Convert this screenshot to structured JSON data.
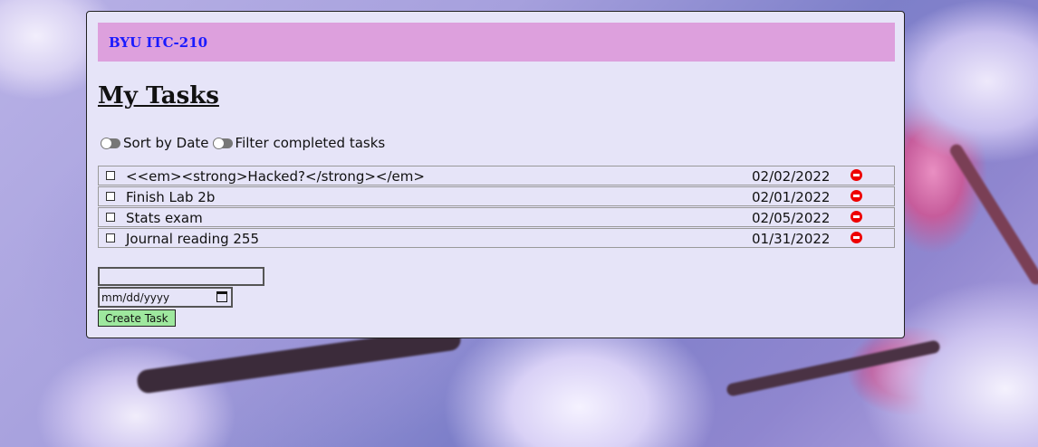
{
  "header": {
    "brand": "BYU ITC-210"
  },
  "page": {
    "title": "My Tasks"
  },
  "controls": {
    "sort_label": "Sort by Date",
    "filter_label": "Filter completed tasks"
  },
  "tasks": [
    {
      "name": "<<em><strong>Hacked?</strong></em>",
      "date": "02/02/2022",
      "completed": false
    },
    {
      "name": "Finish Lab 2b",
      "date": "02/01/2022",
      "completed": false
    },
    {
      "name": "Stats exam",
      "date": "02/05/2022",
      "completed": false
    },
    {
      "name": "Journal reading 255",
      "date": "01/31/2022",
      "completed": false
    }
  ],
  "form": {
    "name_value": "",
    "date_placeholder": "mm/dd/yyyy",
    "create_label": "Create Task"
  },
  "icons": {
    "delete": "minus-circle-icon",
    "calendar": "calendar-icon",
    "checkbox": "checkbox-icon"
  },
  "colors": {
    "header_bg": "#dda0dd",
    "brand_text": "#1a1aff",
    "panel_bg": "#e6e4f8",
    "create_button_bg": "#9ee89e",
    "delete_icon": "#ee0000"
  }
}
